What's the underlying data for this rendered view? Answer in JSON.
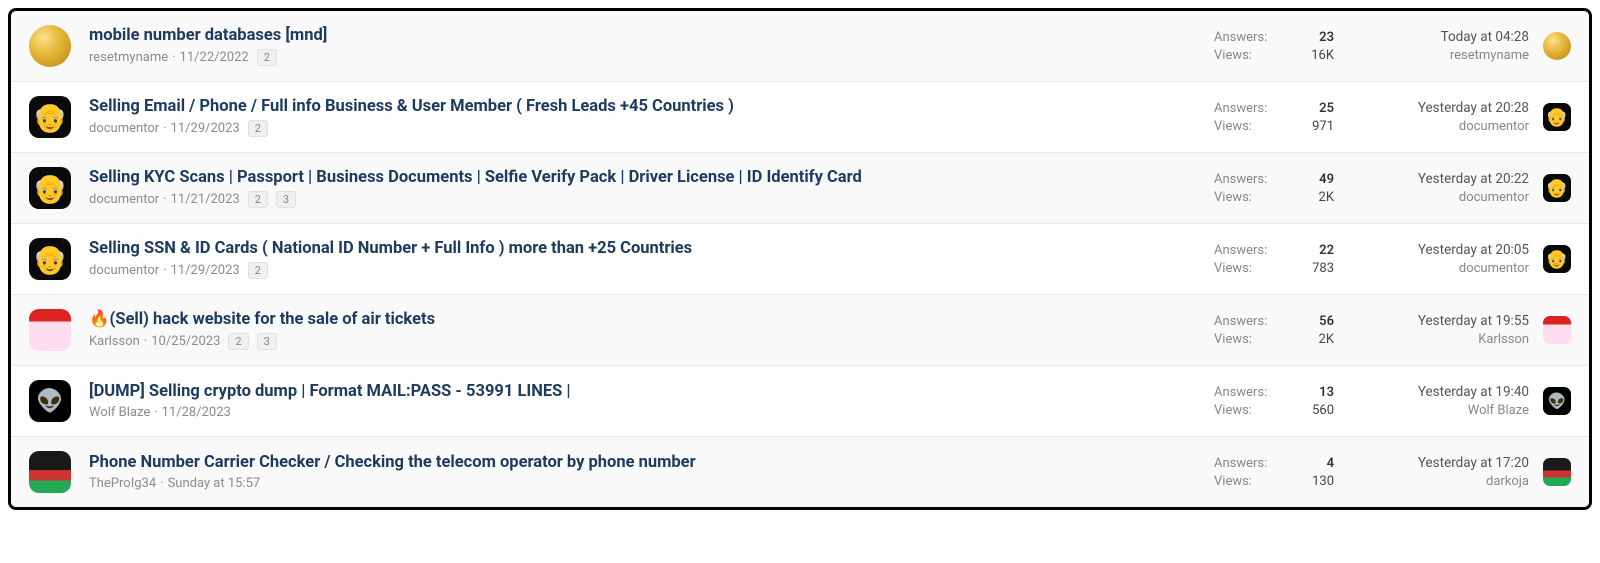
{
  "labels": {
    "answers": "Answers:",
    "views": "Views:"
  },
  "threads": [
    {
      "title": "mobile number databases [mnd]",
      "author": "resetmyname",
      "date": "11/22/2022",
      "pages": [
        "2"
      ],
      "answers": "23",
      "views": "16K",
      "last_time": "Today at 04:28",
      "last_user": "resetmyname",
      "avatar_class": "gold",
      "last_avatar_class": "gold",
      "alt": true
    },
    {
      "title": "Selling Email / Phone / Full info Business & User Member ( Fresh Leads +45 Countries )",
      "author": "documentor",
      "date": "11/29/2023",
      "pages": [
        "2"
      ],
      "answers": "25",
      "views": "971",
      "last_time": "Yesterday at 20:28",
      "last_user": "documentor",
      "avatar_class": "darkface",
      "last_avatar_class": "darkface",
      "alt": false
    },
    {
      "title": "Selling KYC Scans | Passport | Business Documents | Selfie Verify Pack | Driver License | ID Identify Card",
      "author": "documentor",
      "date": "11/21/2023",
      "pages": [
        "2",
        "3"
      ],
      "answers": "49",
      "views": "2K",
      "last_time": "Yesterday at 20:22",
      "last_user": "documentor",
      "avatar_class": "darkface",
      "last_avatar_class": "darkface",
      "alt": true
    },
    {
      "title": "Selling SSN & ID Cards ( National ID Number + Full Info ) more than +25 Countries",
      "author": "documentor",
      "date": "11/29/2023",
      "pages": [
        "2"
      ],
      "answers": "22",
      "views": "783",
      "last_time": "Yesterday at 20:05",
      "last_user": "documentor",
      "avatar_class": "darkface",
      "last_avatar_class": "darkface",
      "alt": false
    },
    {
      "title": "🔥(Sell) hack website for the sale of air tickets",
      "author": "Karlsson",
      "date": "10/25/2023",
      "pages": [
        "2",
        "3"
      ],
      "answers": "56",
      "views": "2K",
      "last_time": "Yesterday at 19:55",
      "last_user": "Karlsson",
      "avatar_class": "santa",
      "last_avatar_class": "santa",
      "alt": true
    },
    {
      "title": "[DUMP] Selling crypto dump | Format MAIL:PASS - 53991 LINES |",
      "author": "Wolf Blaze",
      "date": "11/28/2023",
      "pages": [],
      "answers": "13",
      "views": "560",
      "last_time": "Yesterday at 19:40",
      "last_user": "Wolf Blaze",
      "avatar_class": "alien",
      "last_avatar_class": "alien",
      "alt": false
    },
    {
      "title": "Phone Number Carrier Checker / Checking the telecom operator by phone number",
      "author": "TheProIg34",
      "date": "Sunday at 15:57",
      "pages": [],
      "answers": "4",
      "views": "130",
      "last_time": "Yesterday at 17:20",
      "last_user": "darkoja",
      "avatar_class": "flag",
      "last_avatar_class": "flag",
      "alt": true
    }
  ]
}
